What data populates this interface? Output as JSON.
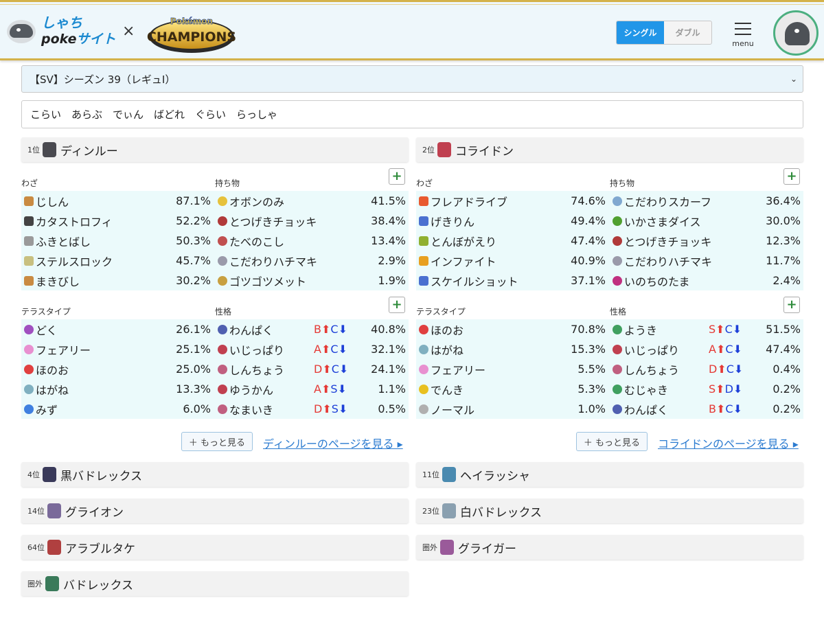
{
  "header": {
    "logo_line1": "しゃち",
    "logo_line2_a": "poke",
    "logo_line2_b": "サイト",
    "times": "×",
    "champions_logo_text": "CHAMPIONS",
    "champions_logo_small": "Pokémon",
    "mode_single": "シングル",
    "mode_double": "ダブル",
    "menu_label": "menu"
  },
  "season": {
    "selected": "【SV】シーズン 39（レギュI）"
  },
  "team_input": {
    "value": "こらい　あらぶ　でぃん　ばどれ　ぐらい　らっしゃ"
  },
  "colors": {
    "accent": "#2196e8",
    "panel_bg": "#ebfafb",
    "gold": "#d4b24a",
    "link": "#2b7bd0"
  },
  "details": [
    {
      "rank": "1位",
      "name": "ディンルー",
      "icon": "dinlu-icon",
      "labels": {
        "moves": "わざ",
        "items": "持ち物",
        "tera": "テラスタイプ",
        "nature": "性格"
      },
      "moves": [
        {
          "name": "じしん",
          "pct": "87.1%",
          "color": "#c98b42"
        },
        {
          "name": "カタストロフィ",
          "pct": "52.2%",
          "color": "#444444"
        },
        {
          "name": "ふきとばし",
          "pct": "50.3%",
          "color": "#9a9a9a"
        },
        {
          "name": "ステルスロック",
          "pct": "45.7%",
          "color": "#c8c080"
        },
        {
          "name": "まきびし",
          "pct": "30.2%",
          "color": "#c98b42"
        }
      ],
      "items": [
        {
          "name": "オボンのみ",
          "pct": "41.5%",
          "color": "#e6c23c"
        },
        {
          "name": "とつげきチョッキ",
          "pct": "38.4%",
          "color": "#b03a3a"
        },
        {
          "name": "たべのこし",
          "pct": "13.4%",
          "color": "#c05050"
        },
        {
          "name": "こだわりハチマキ",
          "pct": "2.9%",
          "color": "#9a9aaa"
        },
        {
          "name": "ゴツゴツメット",
          "pct": "1.9%",
          "color": "#c8a040"
        }
      ],
      "tera": [
        {
          "name": "どく",
          "pct": "26.1%",
          "color": "#a050c0"
        },
        {
          "name": "フェアリー",
          "pct": "25.1%",
          "color": "#e890d0"
        },
        {
          "name": "ほのお",
          "pct": "25.0%",
          "color": "#e04040"
        },
        {
          "name": "はがね",
          "pct": "13.3%",
          "color": "#80b0c0"
        },
        {
          "name": "みず",
          "pct": "6.0%",
          "color": "#4080e0"
        }
      ],
      "natures": [
        {
          "name": "わんぱく",
          "up": "B",
          "down": "C",
          "pct": "40.8%",
          "color": "#5060b0"
        },
        {
          "name": "いじっぱり",
          "up": "A",
          "down": "C",
          "pct": "32.1%",
          "color": "#c04050"
        },
        {
          "name": "しんちょう",
          "up": "D",
          "down": "C",
          "pct": "24.1%",
          "color": "#c06080"
        },
        {
          "name": "ゆうかん",
          "up": "A",
          "down": "S",
          "pct": "1.1%",
          "color": "#c04050"
        },
        {
          "name": "なまいき",
          "up": "D",
          "down": "S",
          "pct": "0.5%",
          "color": "#c06080"
        }
      ],
      "more": "＋ もっと見る",
      "page_link": "ディンルーのページを見る ▸"
    },
    {
      "rank": "2位",
      "name": "コライドン",
      "icon": "koraidon-icon",
      "labels": {
        "moves": "わざ",
        "items": "持ち物",
        "tera": "テラスタイプ",
        "nature": "性格"
      },
      "moves": [
        {
          "name": "フレアドライブ",
          "pct": "74.6%",
          "color": "#e85a30"
        },
        {
          "name": "げきりん",
          "pct": "49.4%",
          "color": "#4a70d0"
        },
        {
          "name": "とんぼがえり",
          "pct": "47.4%",
          "color": "#90b030"
        },
        {
          "name": "インファイト",
          "pct": "40.9%",
          "color": "#e8a020"
        },
        {
          "name": "スケイルショット",
          "pct": "37.1%",
          "color": "#4a70d0"
        }
      ],
      "items": [
        {
          "name": "こだわりスカーフ",
          "pct": "36.4%",
          "color": "#80a8d0"
        },
        {
          "name": "いかさまダイス",
          "pct": "30.0%",
          "color": "#50a030"
        },
        {
          "name": "とつげきチョッキ",
          "pct": "12.3%",
          "color": "#b03a3a"
        },
        {
          "name": "こだわりハチマキ",
          "pct": "11.7%",
          "color": "#9a9aaa"
        },
        {
          "name": "いのちのたま",
          "pct": "2.4%",
          "color": "#c03080"
        }
      ],
      "tera": [
        {
          "name": "ほのお",
          "pct": "70.8%",
          "color": "#e04040"
        },
        {
          "name": "はがね",
          "pct": "15.3%",
          "color": "#80b0c0"
        },
        {
          "name": "フェアリー",
          "pct": "5.5%",
          "color": "#e890d0"
        },
        {
          "name": "でんき",
          "pct": "5.3%",
          "color": "#e8c020"
        },
        {
          "name": "ノーマル",
          "pct": "1.0%",
          "color": "#b0b0b0"
        }
      ],
      "natures": [
        {
          "name": "ようき",
          "up": "S",
          "down": "C",
          "pct": "51.5%",
          "color": "#40a060"
        },
        {
          "name": "いじっぱり",
          "up": "A",
          "down": "C",
          "pct": "47.4%",
          "color": "#c04050"
        },
        {
          "name": "しんちょう",
          "up": "D",
          "down": "C",
          "pct": "0.4%",
          "color": "#c06080"
        },
        {
          "name": "むじゃき",
          "up": "S",
          "down": "D",
          "pct": "0.2%",
          "color": "#40a060"
        },
        {
          "name": "わんぱく",
          "up": "B",
          "down": "C",
          "pct": "0.2%",
          "color": "#5060b0"
        }
      ],
      "more": "＋ もっと見る",
      "page_link": "コライドンのページを見る ▸"
    }
  ],
  "rankings": [
    {
      "rank": "4位",
      "name": "黒バドレックス",
      "icon": "calyrex-shadow-icon",
      "color": "#3a3a5a"
    },
    {
      "rank": "11位",
      "name": "ヘイラッシャ",
      "icon": "dondozo-icon",
      "color": "#4a8ab0"
    },
    {
      "rank": "14位",
      "name": "グライオン",
      "icon": "gliscor-icon",
      "color": "#7a6a9a"
    },
    {
      "rank": "23位",
      "name": "白バドレックス",
      "icon": "calyrex-ice-icon",
      "color": "#8aa0b0"
    },
    {
      "rank": "64位",
      "name": "アラブルタケ",
      "icon": "brute-bonnet-icon",
      "color": "#b04040"
    },
    {
      "rank": "圏外",
      "name": "グライガー",
      "icon": "gligar-icon",
      "color": "#9a5a9a"
    },
    {
      "rank": "圏外",
      "name": "バドレックス",
      "icon": "calyrex-icon",
      "color": "#3a7a5a"
    }
  ]
}
